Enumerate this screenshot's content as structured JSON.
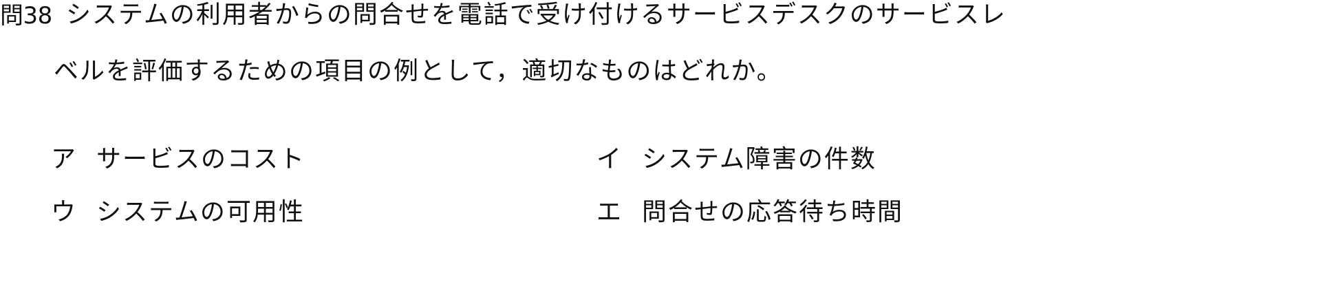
{
  "question": {
    "number": "問38",
    "line1": "システムの利用者からの問合せを電話で受け付けるサービスデスクのサービスレ",
    "line2": "ベルを評価するための項目の例として，適切なものはどれか。"
  },
  "choices": [
    {
      "marker": "ア",
      "text": "サービスのコスト"
    },
    {
      "marker": "イ",
      "text": "システム障害の件数"
    },
    {
      "marker": "ウ",
      "text": "システムの可用性"
    },
    {
      "marker": "エ",
      "text": "問合せの応答待ち時間"
    }
  ]
}
